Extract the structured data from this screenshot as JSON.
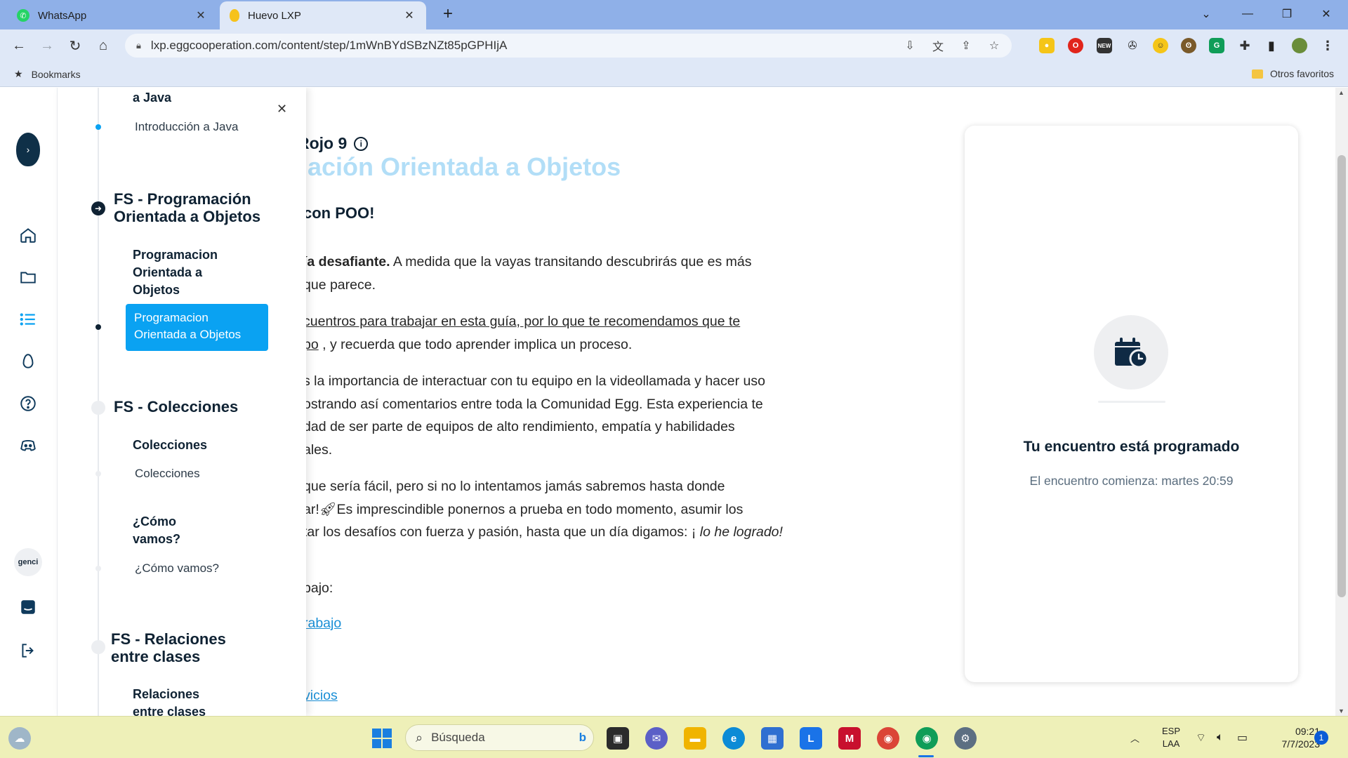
{
  "tabs": [
    {
      "title": "WhatsApp",
      "icon": "whatsapp-icon",
      "active": false
    },
    {
      "title": "Huevo LXP",
      "icon": "egg-icon",
      "active": true
    }
  ],
  "address": {
    "url": "lxp.eggcooperation.com/content/step/1mWnBYdSBzNZt85pGPHIjA"
  },
  "bookmarks": {
    "label": "Bookmarks",
    "others": "Otros favoritos"
  },
  "rail": {
    "avatar_text": "genci"
  },
  "outline": {
    "top_section_tail": "a Java",
    "items": {
      "intro_java": "Introducción a Java",
      "poo_section": "FS - Programación Orientada a Objetos",
      "poo_sub": "Programacion Orientada a Objetos",
      "poo_active": "Programacion Orientada a Objetos",
      "colecciones_section": "FS - Colecciones",
      "colecciones_sub": "Colecciones",
      "colecciones_item": "Colecciones",
      "como_sub": "¿Cómo vamos?",
      "como_item": "¿Cómo vamos?",
      "relaciones_section": "FS - Relaciones entre clases",
      "relaciones_sub": "Relaciones entre clases"
    }
  },
  "content": {
    "heading": "Rojo 9",
    "faded_title": "mación Orientada a Objetos",
    "subheading": "con POO!",
    "p1_bold": "ía desafiante.",
    "p1_rest": " A medida que la vayas transitando descubrirás que es más",
    "p1_line2": "que parece.",
    "p2_underlined": "cuentros para trabajar en esta guía, por lo que te recomendamos que te",
    "p2_line2_ul": "po",
    "p2_line2_rest": " , y recuerda que todo aprender implica un proceso.",
    "p3_l1": "s la importancia de interactuar con tu equipo en la videollamada y hacer uso",
    "p3_l2": "ostrando así comentarios entre toda la Comunidad Egg. Esta experiencia te",
    "p3_l3": "dad de ser parte de equipos de alto rendimiento, empatía y habilidades",
    "p3_l4": "ales.",
    "p4_l1": "que sería fácil, pero si no lo intentamos jamás sabremos hasta donde",
    "p4_l2_a": "ar!",
    "p4_l2_b": "Es imprescindible ponernos a prueba en todo momento, asumir los",
    "p4_l3_a": "tar los desafíos con fuerza y pasión, hasta que un día digamos: ¡ ",
    "p4_l3_em": "lo he logrado!",
    "p5": "bajo:",
    "link1": "rabajo",
    "link2": "vicios"
  },
  "meeting_card": {
    "title": "Tu encuentro está programado",
    "subtitle": "El encuentro comienza: martes 20:59"
  },
  "taskbar": {
    "search_placeholder": "Búsqueda",
    "lang_top": "ESP",
    "lang_bottom": "LAA",
    "time": "09:21",
    "date": "7/7/2023",
    "notification_count": "1"
  },
  "colors": {
    "accent": "#0aa2f2",
    "navy": "#0f2233",
    "tabbar": "#8fb0e8",
    "toolbar": "#dfe8f7"
  }
}
